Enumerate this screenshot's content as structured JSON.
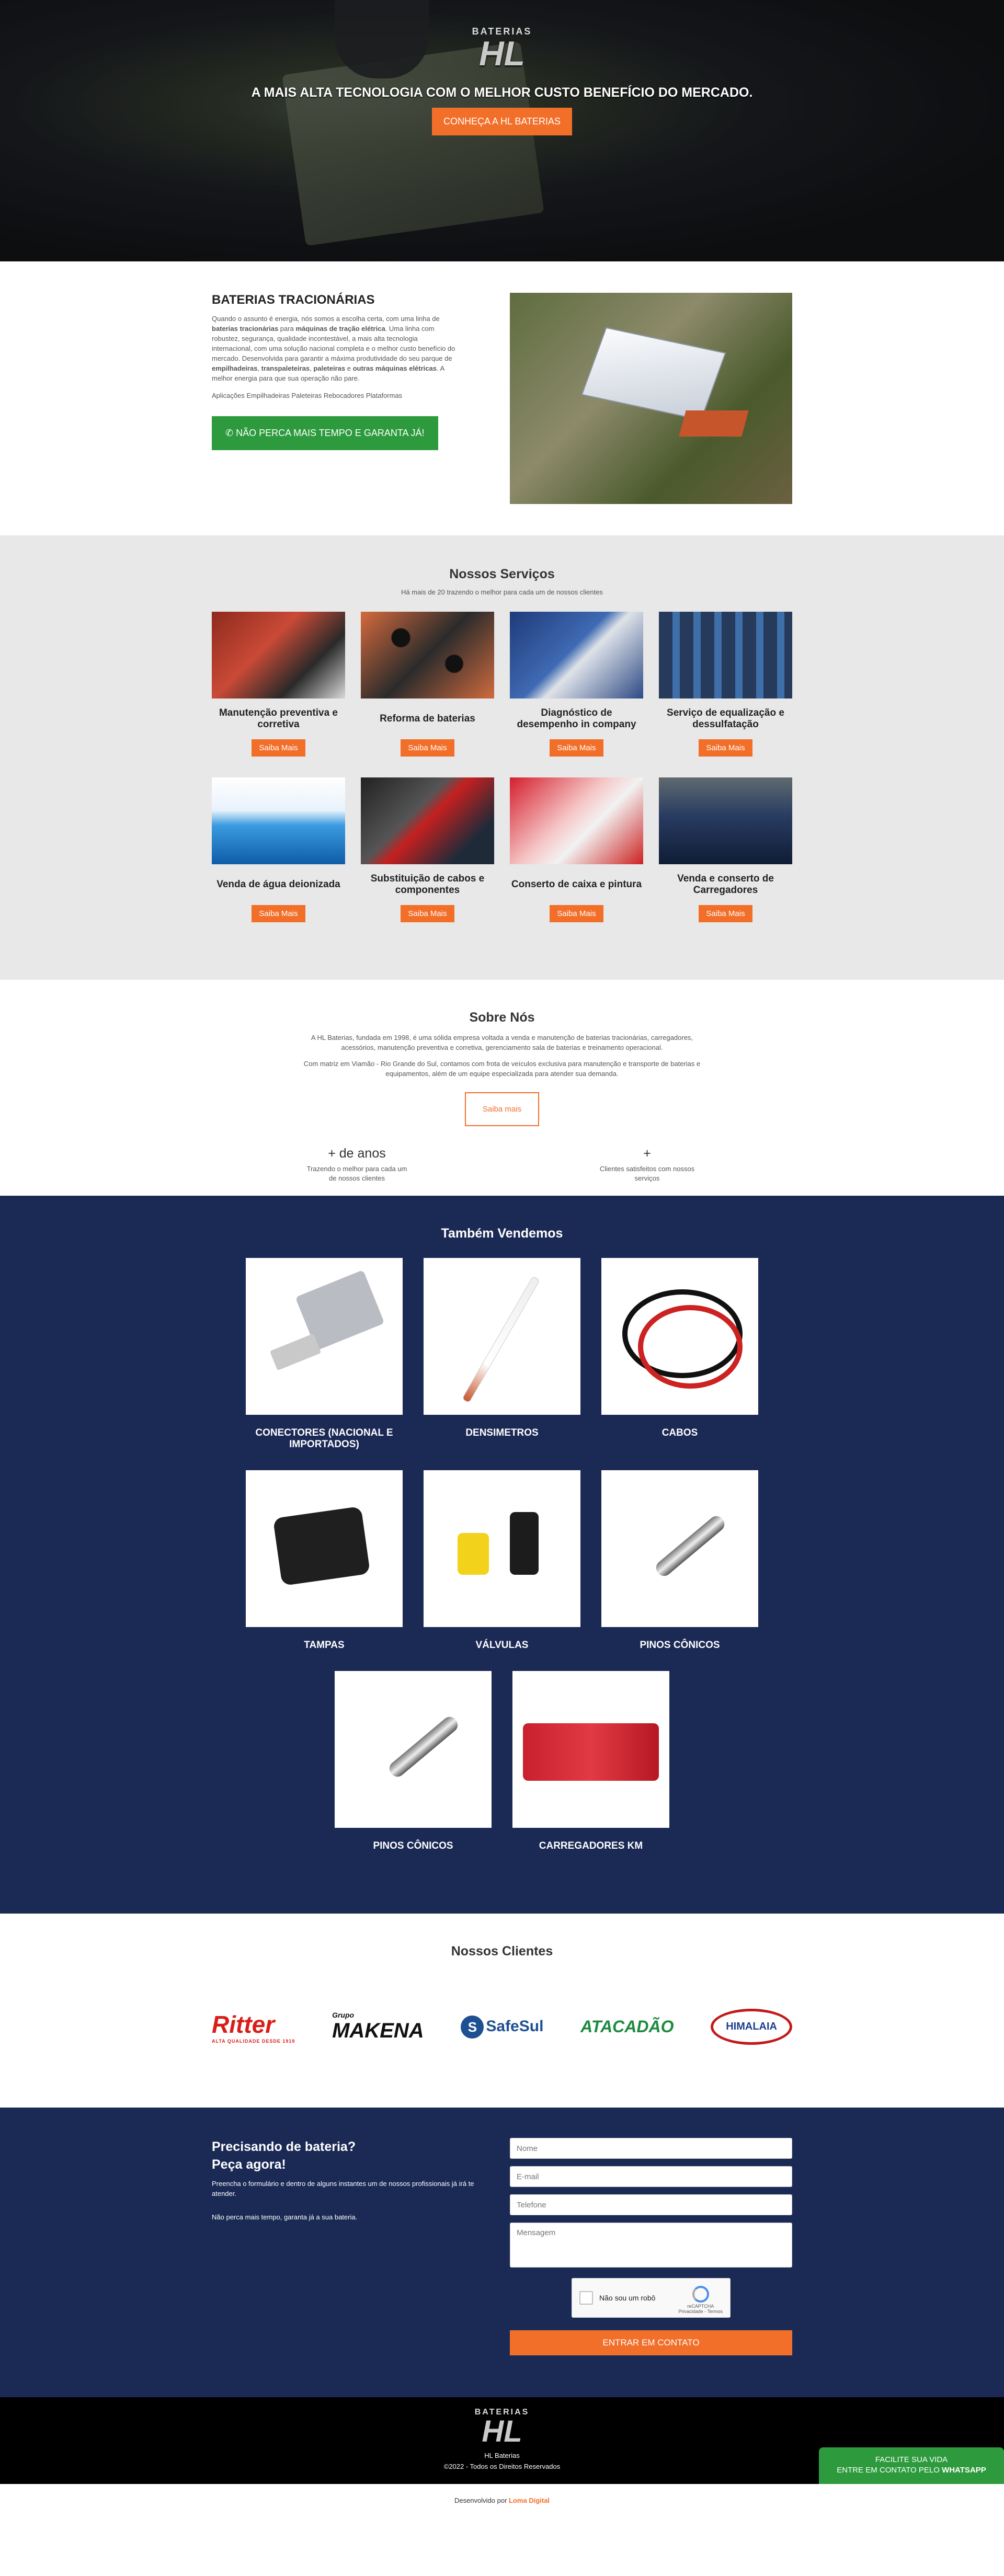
{
  "hero": {
    "logo_top": "BATERIAS",
    "logo_main": "HL",
    "title": "A MAIS ALTA TECNOLOGIA COM O MELHOR CUSTO BENEFÍCIO DO MERCADO.",
    "button": "CONHEÇA A HL BATERIAS"
  },
  "intro": {
    "title": "BATERIAS TRACIONÁRIAS",
    "p1_a": "Quando o assunto é energia, nós somos a escolha certa, com uma linha de ",
    "p1_b": "baterias tracionárias",
    "p1_c": " para ",
    "p1_d": "máquinas de tração elétrica",
    "p1_e": ". Uma linha com robustez, segurança, qualidade incontestável, a mais alta tecnologia internacional, com uma solução nacional completa e o melhor custo benefício do mercado. Desenvolvida para garantir a máxima produtividade do seu parque de ",
    "p1_f": "empilhadeiras",
    "p1_g": ", ",
    "p1_h": "transpaleteiras",
    "p1_i": ", ",
    "p1_j": "paleteiras",
    "p1_k": " e ",
    "p1_l": "outras máquinas elétricas",
    "p1_m": ". A melhor energia para que sua operação não pare.",
    "apps": "Aplicações Empilhadeiras Paleteiras Rebocadores Plataformas",
    "button": "NÃO PERCA MAIS TEMPO E GARANTA JÁ!"
  },
  "services": {
    "title": "Nossos Serviços",
    "subtitle": "Há mais de 20 trazendo o melhor para cada um de nossos clientes",
    "button": "Saiba Mais",
    "items": [
      {
        "name": "Manutenção preventiva e corretiva"
      },
      {
        "name": "Reforma de baterias"
      },
      {
        "name": "Diagnóstico de desempenho in company"
      },
      {
        "name": "Serviço de equalização e dessulfatação"
      },
      {
        "name": "Venda de água deionizada"
      },
      {
        "name": "Substituição de cabos e componentes"
      },
      {
        "name": "Conserto de caixa e pintura"
      },
      {
        "name": "Venda e conserto de Carregadores"
      }
    ]
  },
  "about": {
    "title": "Sobre Nós",
    "p1": "A HL Baterias, fundada em 1998, é uma sólida empresa voltada a venda e manutenção de baterias tracionárias, carregadores, acessórios, manutenção preventiva e corretiva, gerenciamento sala de baterias e treinamento operacional.",
    "p2": "Com matriz em Viamão - Rio Grande do Sul, contamos com frota de veículos exclusiva para manutenção e transporte de baterias e equipamentos, além de um equipe especializada para atender sua demanda.",
    "button": "Saiba mais",
    "stats": [
      {
        "num": "+ de anos",
        "desc": "Trazendo o melhor para cada um de nossos clientes"
      },
      {
        "num": "+",
        "desc": "Clientes satisfeitos com nossos serviços"
      }
    ]
  },
  "sell": {
    "title": "Também Vendemos",
    "items": [
      {
        "name": "CONECTORES (NACIONAL E IMPORTADOS)"
      },
      {
        "name": "DENSIMETROS"
      },
      {
        "name": "CABOS"
      },
      {
        "name": "TAMPAS"
      },
      {
        "name": "VÁLVULAS"
      },
      {
        "name": "PINOS CÔNICOS"
      },
      {
        "name": "PINOS CÔNICOS"
      },
      {
        "name": "CARREGADORES KM"
      }
    ]
  },
  "clients": {
    "title": "Nossos Clientes",
    "ritter": "Ritter",
    "ritter_tag": "ALTA QUALIDADE DESDE 1919",
    "makena_top": "Grupo",
    "makena": "MAKENA",
    "safesul": "SafeSul",
    "atacadao_a": "A",
    "atacadao": "TACADÃO",
    "himalaia": "HIMALAIA"
  },
  "contact": {
    "title1": "Precisando de bateria?",
    "title2": "Peça agora!",
    "p1": "Preencha o formulário e dentro de alguns instantes um de nossos profissionais já irá te atender.",
    "p2": "Não perca mais tempo, garanta já a sua bateria.",
    "name_ph": "Nome",
    "email_ph": "E-mail",
    "phone_ph": "Telefone",
    "msg_ph": "Mensagem",
    "captcha": "Não sou um robô",
    "captcha_brand": "reCAPTCHA",
    "captcha_links": "Privacidade - Termos",
    "send": "ENTRAR EM CONTATO"
  },
  "footer": {
    "logo_top": "BATERIAS",
    "logo_main": "HL",
    "name": "HL Baterias",
    "copy": "©2022 - Todos os Direitos Reservados",
    "dev_prefix": "Desenvolvido por",
    "dev_name": "Loma Digital"
  },
  "whatsapp": {
    "line1": "FACILITE SUA VIDA",
    "line2_a": "ENTRE EM CONTATO PELO ",
    "line2_b": "WHATSAPP"
  }
}
